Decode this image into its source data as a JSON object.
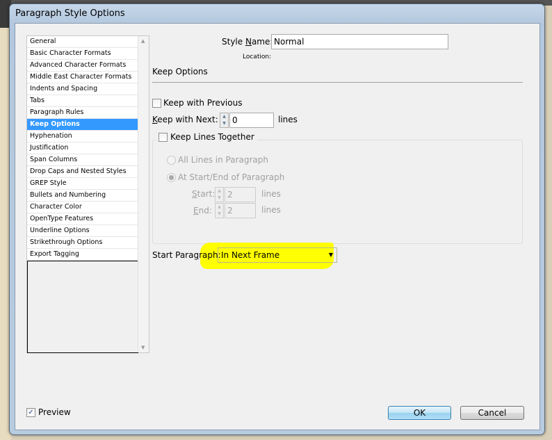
{
  "window": {
    "title": "Paragraph Style Options"
  },
  "sidebar": {
    "items": [
      {
        "label": "General"
      },
      {
        "label": "Basic Character Formats"
      },
      {
        "label": "Advanced Character Formats"
      },
      {
        "label": "Middle East Character Formats"
      },
      {
        "label": "Indents and Spacing"
      },
      {
        "label": "Tabs"
      },
      {
        "label": "Paragraph Rules"
      },
      {
        "label": "Keep Options",
        "selected": true
      },
      {
        "label": "Hyphenation"
      },
      {
        "label": "Justification"
      },
      {
        "label": "Span Columns"
      },
      {
        "label": "Drop Caps and Nested Styles"
      },
      {
        "label": "GREP Style"
      },
      {
        "label": "Bullets and Numbering"
      },
      {
        "label": "Character Color"
      },
      {
        "label": "OpenType Features"
      },
      {
        "label": "Underline Options"
      },
      {
        "label": "Strikethrough Options"
      },
      {
        "label": "Export Tagging"
      }
    ]
  },
  "main": {
    "style_name_label_pre": "Style ",
    "style_name_label_u": "N",
    "style_name_label_post": "ame:",
    "style_name_value": "Normal",
    "location_label": "Location:",
    "section_title": "Keep Options",
    "keep_with_previous": {
      "label": "Keep with Previous",
      "checked": false
    },
    "keep_with_next": {
      "label_u": "K",
      "label_rest": "eep with Next:",
      "value": "0",
      "unit": "lines"
    },
    "keep_lines_together": {
      "label": "Keep Lines Together",
      "checked": false,
      "all_lines": "All Lines in Paragraph",
      "at_start_end": "At Start/End of Paragraph",
      "start_u": "S",
      "start_rest": "tart:",
      "start_value": "2",
      "end_u": "E",
      "end_rest": "nd:",
      "end_value": "2",
      "unit": "lines"
    },
    "start_paragraph": {
      "label_pre": "Start Para",
      "label_u": "g",
      "label_post": "raph:",
      "value": "In Next Frame",
      "highlight": "#ffff00"
    }
  },
  "footer": {
    "preview_label": "Preview",
    "preview_checked": true,
    "ok_label": "OK",
    "cancel_label": "Cancel"
  }
}
